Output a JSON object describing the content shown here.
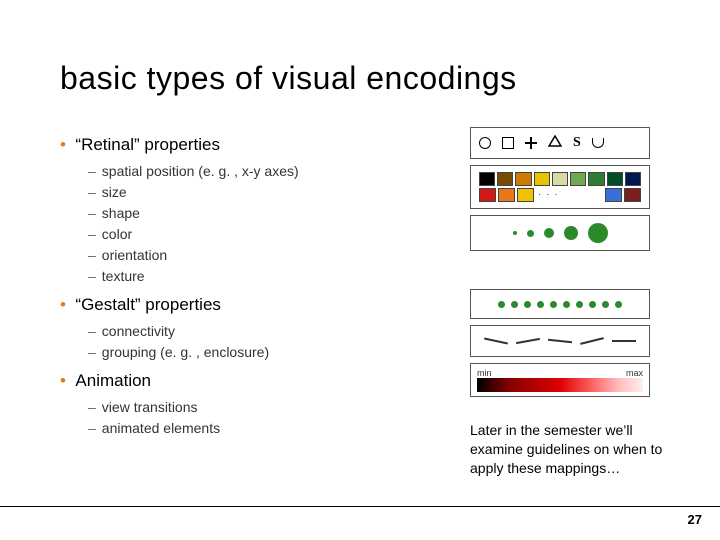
{
  "title": "basic types of visual encodings",
  "sections": [
    {
      "label": "“Retinal” properties",
      "items": [
        "spatial position (e. g. , x-y axes)",
        "size",
        "shape",
        "color",
        "orientation",
        "texture"
      ]
    },
    {
      "label": "“Gestalt” properties",
      "items": [
        "connectivity",
        "grouping (e. g. , enclosure)"
      ]
    },
    {
      "label": "Animation",
      "items": [
        "view transitions",
        "animated elements"
      ]
    }
  ],
  "note": "Later in the semester we’ll examine guidelines on when to apply these mappings…",
  "page_number": "27",
  "gradient": {
    "min": "min",
    "max": "max"
  },
  "colors_row1": [
    "#000000",
    "#7a4a00",
    "#cc7a00",
    "#e6c400",
    "#d9d9a6",
    "#6fa84f",
    "#2e7d32",
    "#004d26",
    "#001a4d"
  ],
  "colors_row2": [
    "#d01919",
    "#e67817",
    "#f2c200",
    "#ffffff",
    "#ffffff",
    "#ffffff",
    "#ffffff",
    "#3a6fd8",
    "#7a1f1f"
  ]
}
